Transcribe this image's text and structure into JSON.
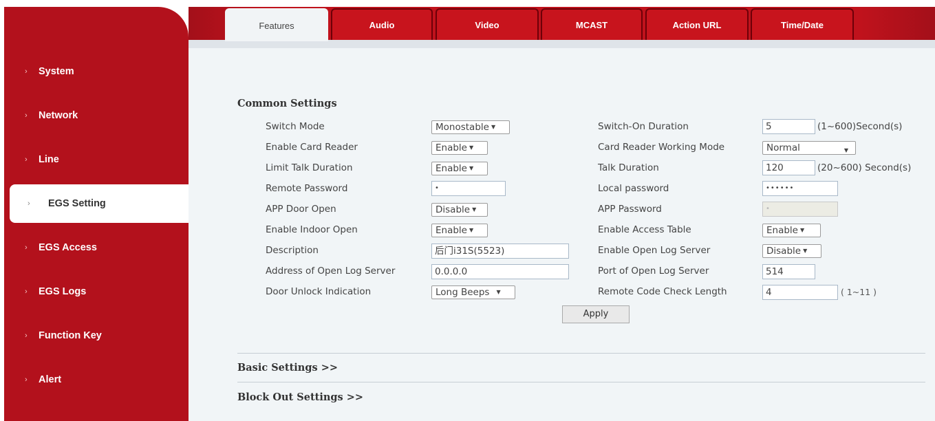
{
  "sidebar": {
    "items": [
      {
        "label": "System"
      },
      {
        "label": "Network"
      },
      {
        "label": "Line"
      },
      {
        "label": "EGS Setting"
      },
      {
        "label": "EGS Access"
      },
      {
        "label": "EGS Logs"
      },
      {
        "label": "Function Key"
      },
      {
        "label": "Alert"
      }
    ],
    "active_index": 3
  },
  "tabs": [
    "Features",
    "Audio",
    "Video",
    "MCAST",
    "Action URL",
    "Time/Date"
  ],
  "active_tab": 0,
  "common": {
    "title": "Common Settings",
    "rows": [
      {
        "label": "Switch Mode",
        "value": "Monostable",
        "r_label": "Switch-On Duration",
        "r_value": "5",
        "r_unit": "(1~600)Second(s)"
      },
      {
        "label": "Enable Card Reader",
        "value": "Enable",
        "r_label": "Card Reader Working Mode",
        "r_value": "Normal"
      },
      {
        "label": "Limit Talk Duration",
        "value": "Enable",
        "r_label": "Talk Duration",
        "r_value": "120",
        "r_unit": "(20~600) Second(s)"
      },
      {
        "label": "Remote Password",
        "value": "•",
        "r_label": "Local password",
        "r_value": "••••••"
      },
      {
        "label": "APP Door Open",
        "value": "Disable",
        "r_label": "APP Password",
        "r_value": "•"
      },
      {
        "label": "Enable Indoor Open",
        "value": "Enable",
        "r_label": "Enable Access Table",
        "r_value": "Enable"
      },
      {
        "label": "Description",
        "value": "后门i31S(5523)",
        "r_label": "Enable Open Log Server",
        "r_value": "Disable"
      },
      {
        "label": "Address of Open Log Server",
        "value": "0.0.0.0",
        "r_label": "Port of Open Log Server",
        "r_value": "514"
      },
      {
        "label": "Door Unlock Indication",
        "value": "Long Beeps",
        "r_label": "Remote Code Check Length",
        "r_value": "4",
        "r_unit": "( 1~11 )"
      }
    ],
    "apply_label": "Apply"
  },
  "sections": {
    "basic": "Basic Settings >>",
    "block_out": "Block Out Settings >>"
  },
  "colors": {
    "brand_red": "#b3111c",
    "panel_bg": "#f1f5f7"
  }
}
